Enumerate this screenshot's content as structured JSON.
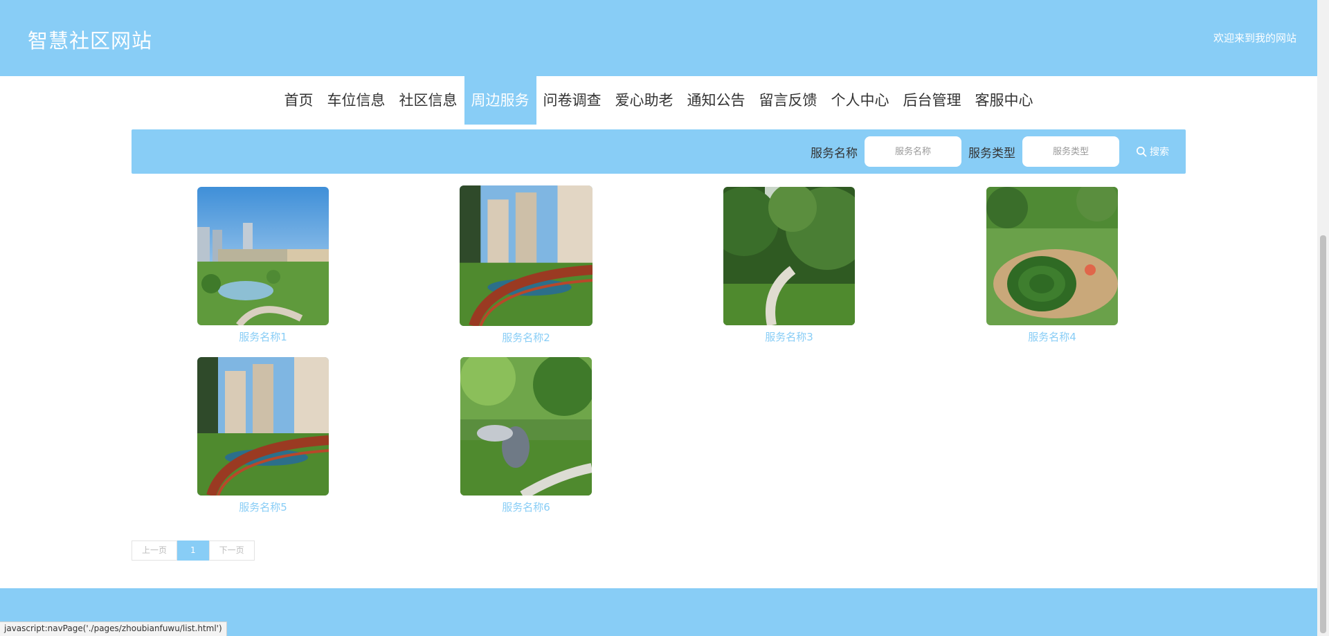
{
  "header": {
    "title": "智慧社区网站",
    "welcome": "欢迎来到我的网站"
  },
  "nav": {
    "items": [
      {
        "label": "首页"
      },
      {
        "label": "车位信息"
      },
      {
        "label": "社区信息"
      },
      {
        "label": "周边服务",
        "active": true
      },
      {
        "label": "问卷调查"
      },
      {
        "label": "爱心助老"
      },
      {
        "label": "通知公告"
      },
      {
        "label": "留言反馈"
      },
      {
        "label": "个人中心"
      },
      {
        "label": "后台管理"
      },
      {
        "label": "客服中心"
      }
    ]
  },
  "search": {
    "name_label": "服务名称",
    "name_placeholder": "服务名称",
    "type_label": "服务类型",
    "type_placeholder": "服务类型",
    "button_label": "搜索",
    "button_icon": "search-icon"
  },
  "services": [
    {
      "title": "服务名称1"
    },
    {
      "title": "服务名称2"
    },
    {
      "title": "服务名称3"
    },
    {
      "title": "服务名称4"
    },
    {
      "title": "服务名称5"
    },
    {
      "title": "服务名称6"
    }
  ],
  "pagination": {
    "prev": "上一页",
    "current": "1",
    "next": "下一页"
  },
  "status_url": "javascript:navPage('./pages/zhoubianfuwu/list.html')",
  "colors": {
    "accent": "#88cdf6",
    "link": "#88cdf6"
  }
}
